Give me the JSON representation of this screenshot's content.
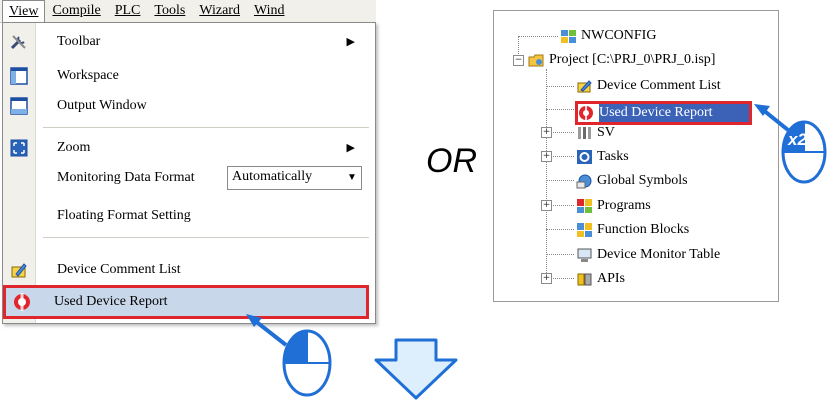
{
  "menubar": {
    "items": [
      "View",
      "Compile",
      "PLC",
      "Tools",
      "Wizard",
      "Wind"
    ]
  },
  "view_menu": {
    "items": [
      {
        "label": "Toolbar",
        "icon": "toolbar-tools-icon",
        "submenu": true
      },
      {
        "label": "Workspace",
        "icon": "workspace-window-icon"
      },
      {
        "label": "Output Window",
        "icon": "output-window-icon"
      },
      {
        "label": "Zoom",
        "icon": "zoom-icon",
        "submenu": true
      },
      {
        "label": "Monitoring Data Format"
      },
      {
        "label": "Floating Format Setting"
      },
      {
        "label": "Device Comment List",
        "icon": "device-comment-icon"
      },
      {
        "label": "Used Device Report",
        "icon": "used-device-report-icon"
      }
    ],
    "monitoring_format_value": "Automatically"
  },
  "or_label": "OR",
  "project_tree": {
    "root": "NWCONFIG",
    "project": "Project [C:\\PRJ_0\\PRJ_0.isp]",
    "children": [
      "Device Comment List",
      "Used Device Report",
      "SV",
      "Tasks",
      "Global Symbols",
      "Programs",
      "Function Blocks",
      "Device Monitor Table",
      "APIs"
    ]
  },
  "annotations": {
    "double_click_badge": "x2"
  },
  "colors": {
    "highlight_border": "#e0262d",
    "highlight_fill": "#c9d7ea",
    "arrow_blue": "#1f6fd6",
    "down_arrow_fill": "#ddeefc"
  }
}
